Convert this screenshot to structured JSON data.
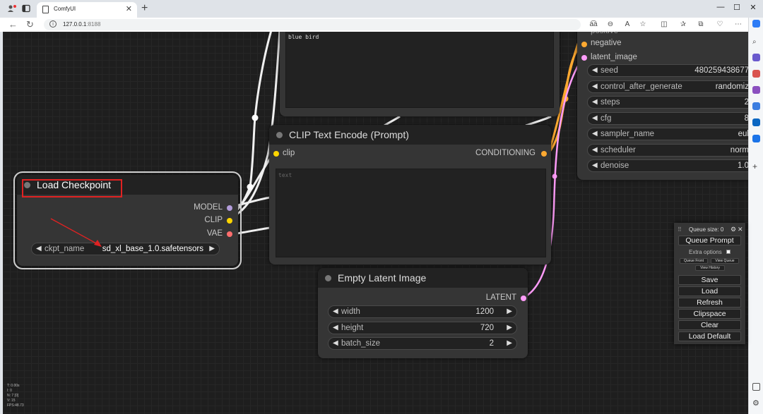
{
  "browser": {
    "tab_title": "ComfyUI",
    "url_host": "127.0.0.1",
    "url_port": ":8188"
  },
  "nodes": {
    "positive_prompt": {
      "text": "blue bird"
    },
    "clip_text_encode": {
      "title": "CLIP Text Encode (Prompt)",
      "input_clip": "clip",
      "output_conditioning": "CONDITIONING",
      "placeholder": "text"
    },
    "load_checkpoint": {
      "title": "Load Checkpoint",
      "outputs": {
        "model": "MODEL",
        "clip": "CLIP",
        "vae": "VAE"
      },
      "ckpt_label": "ckpt_name",
      "ckpt_value": "sd_xl_base_1.0.safetensors"
    },
    "empty_latent": {
      "title": "Empty Latent Image",
      "output": "LATENT",
      "widgets": [
        {
          "label": "width",
          "value": "1200"
        },
        {
          "label": "height",
          "value": "720"
        },
        {
          "label": "batch_size",
          "value": "2"
        }
      ]
    },
    "ksampler": {
      "partial_top": "positive",
      "input_negative": "negative",
      "input_latent": "latent_image",
      "widgets": [
        {
          "label": "seed",
          "value": "48025943867​7"
        },
        {
          "label": "control_after_generate",
          "value": "randomiz"
        },
        {
          "label": "steps",
          "value": "2"
        },
        {
          "label": "cfg",
          "value": "8"
        },
        {
          "label": "sampler_name",
          "value": "eul"
        },
        {
          "label": "scheduler",
          "value": "norm"
        },
        {
          "label": "denoise",
          "value": "1.0"
        }
      ]
    }
  },
  "queue_panel": {
    "queue_size": "Queue size: 0",
    "queue_prompt": "Queue Prompt",
    "extra_options": "Extra options",
    "queue_front": "Queue Front",
    "view_queue": "View Queue",
    "view_history": "View History",
    "buttons": [
      "Save",
      "Load",
      "Refresh",
      "Clipspace",
      "Clear",
      "Load Default"
    ]
  },
  "stats": [
    "T: 0.00s",
    "I: 0",
    "N: 7 [0]",
    "V: 15",
    "FPS:48.73"
  ],
  "colors": {
    "model": "#b39ddb",
    "clip": "#ffd500",
    "vae": "#ff6e6e",
    "conditioning": "#ffa931",
    "latent": "#ff9cf9",
    "highlight": "#e02222"
  }
}
